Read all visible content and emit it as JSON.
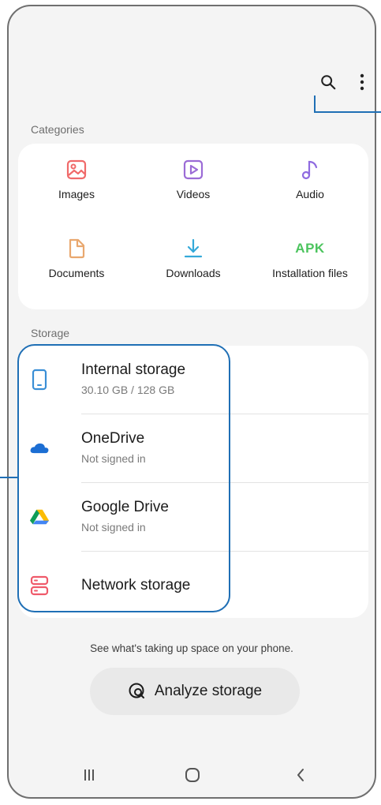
{
  "categories": {
    "title": "Categories",
    "items": [
      {
        "label": "Images",
        "icon": "images-icon"
      },
      {
        "label": "Videos",
        "icon": "videos-icon"
      },
      {
        "label": "Audio",
        "icon": "audio-icon"
      },
      {
        "label": "Documents",
        "icon": "documents-icon"
      },
      {
        "label": "Downloads",
        "icon": "downloads-icon"
      },
      {
        "label": "Installation files",
        "icon": "apk-icon",
        "icon_text": "APK"
      }
    ]
  },
  "storage": {
    "title": "Storage",
    "items": [
      {
        "name": "Internal storage",
        "sub": "30.10 GB / 128 GB",
        "icon": "phone-icon"
      },
      {
        "name": "OneDrive",
        "sub": "Not signed in",
        "icon": "onedrive-icon"
      },
      {
        "name": "Google Drive",
        "sub": "Not signed in",
        "icon": "google-drive-icon"
      },
      {
        "name": "Network storage",
        "icon": "network-storage-icon"
      }
    ]
  },
  "footer": {
    "hint": "See what's taking up space on your phone.",
    "analyze_label": "Analyze storage"
  },
  "toolbar": {
    "search_icon": "search-icon",
    "more_icon": "more-options-icon"
  },
  "navbar": {
    "recents_icon": "recents-icon",
    "home_icon": "home-icon",
    "back_icon": "back-icon"
  },
  "colors": {
    "accent_callout": "#1f6fb5",
    "images": "#f06a6a",
    "videos": "#9b6bd6",
    "audio": "#8f6be0",
    "documents": "#e9a86f",
    "downloads": "#34a9d9",
    "apk": "#4cc45e",
    "phone": "#3a8fd6",
    "network": "#ef5a6a"
  }
}
